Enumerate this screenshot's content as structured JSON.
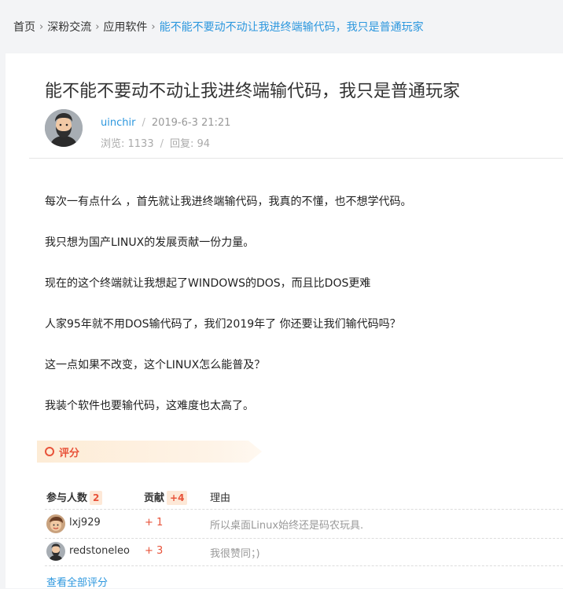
{
  "breadcrumb": {
    "items": [
      "首页",
      "深粉交流",
      "应用软件"
    ],
    "separator": "›",
    "current": "能不能不要动不动让我进终端输代码，我只是普通玩家"
  },
  "post": {
    "title": "能不能不要动不动让我进终端输代码，我只是普通玩家",
    "author": "uinchir",
    "date": "2019-6-3 21:21",
    "views_label": "浏览: 1133",
    "replies_label": "回复: 94",
    "paragraphs": [
      "每次一有点什么 ，首先就让我进终端输代码，我真的不懂，也不想学代码。",
      "我只想为国产LINUX的发展贡献一份力量。",
      "现在的这个终端就让我想起了WINDOWS的DOS，而且比DOS更难",
      "人家95年就不用DOS输代码了，我们2019年了  你还要让我们输代码吗？",
      "这一点如果不改变，这个LINUX怎么能普及？",
      "我装个软件也要输代码，这难度也太高了。"
    ]
  },
  "rating": {
    "tab_label": "评分",
    "header": {
      "participants_label": "参与人数",
      "participants_count": "2",
      "contribution_label": "贡献",
      "contribution_total": "+4",
      "reason_label": "理由"
    },
    "rows": [
      {
        "user": "lxj929",
        "score": "+ 1",
        "reason": "所以桌面Linux始终还是码农玩具."
      },
      {
        "user": "redstoneleo",
        "score": "+ 3",
        "reason": "我很赞同；)"
      }
    ],
    "view_all": "查看全部评分"
  },
  "colors": {
    "accent": "#2c97de",
    "rating": "#e8533a"
  }
}
